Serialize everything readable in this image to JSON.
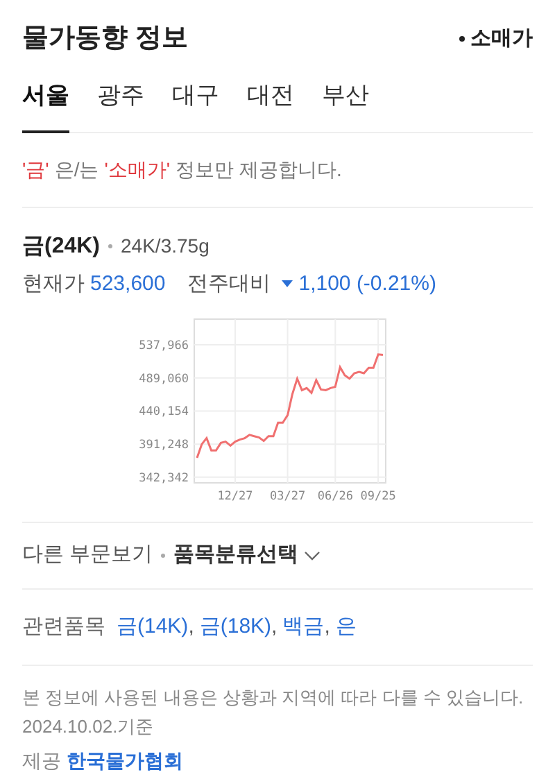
{
  "header": {
    "title": "물가동향 정보",
    "filter": "소매가"
  },
  "tabs": [
    {
      "label": "서울",
      "selected": true
    },
    {
      "label": "광주",
      "selected": false
    },
    {
      "label": "대구",
      "selected": false
    },
    {
      "label": "대전",
      "selected": false
    },
    {
      "label": "부산",
      "selected": false
    }
  ],
  "notice": [
    {
      "text": "'금'",
      "highlight": true
    },
    {
      "text": "은/는",
      "highlight": false
    },
    {
      "text": "'소매가'",
      "highlight": true
    },
    {
      "text": "정보만 제공합니다.",
      "highlight": false
    }
  ],
  "item": {
    "name": "금(24K)",
    "spec": "24K/3.75g",
    "price_label": "현재가",
    "price": "523,600",
    "change_label": "전주대비",
    "falling": true,
    "change": "1,100 (-0.21%)"
  },
  "chart_data": {
    "type": "line",
    "categories": [
      null,
      null,
      null,
      null,
      null,
      null,
      null,
      null,
      "12/27",
      null,
      null,
      null,
      null,
      null,
      null,
      null,
      null,
      null,
      null,
      "03/27",
      null,
      null,
      null,
      null,
      null,
      null,
      null,
      null,
      null,
      "06/26",
      null,
      null,
      null,
      null,
      null,
      null,
      null,
      null,
      "09/25",
      null
    ],
    "series": [
      {
        "color": "#f07070",
        "values": [
          371000,
          391000,
          400000,
          382000,
          382000,
          393000,
          395000,
          389000,
          395000,
          398000,
          400000,
          405000,
          403000,
          401000,
          396000,
          403000,
          403000,
          423000,
          423000,
          434000,
          465000,
          488000,
          471000,
          474000,
          467000,
          486000,
          472000,
          471000,
          474000,
          476000,
          505000,
          493000,
          488000,
          496000,
          498000,
          496000,
          504000,
          504000,
          524000,
          523000
        ]
      }
    ],
    "ylim": [
      334000,
      576000
    ],
    "grid": true,
    "yticks": [
      {
        "value": 342342,
        "label": "342,342"
      },
      {
        "value": 391248,
        "label": "391,248"
      },
      {
        "value": 440154,
        "label": "440,154"
      },
      {
        "value": 489060,
        "label": "489,060"
      },
      {
        "value": 537966,
        "label": "537,966"
      }
    ]
  },
  "category": {
    "label": "다른 부문보기",
    "select": "품목분류선택"
  },
  "related": {
    "label": "관련품목",
    "separator": ",",
    "links": [
      "금(14K)",
      "금(18K)",
      "백금",
      "은"
    ]
  },
  "footer": {
    "notes": [
      "본 정보에 사용된 내용은 상황과 지역에 따라 다를 수 있습니다.",
      "2024.10.02.기준"
    ],
    "source_label": "제공",
    "source": "한국물가협회"
  }
}
